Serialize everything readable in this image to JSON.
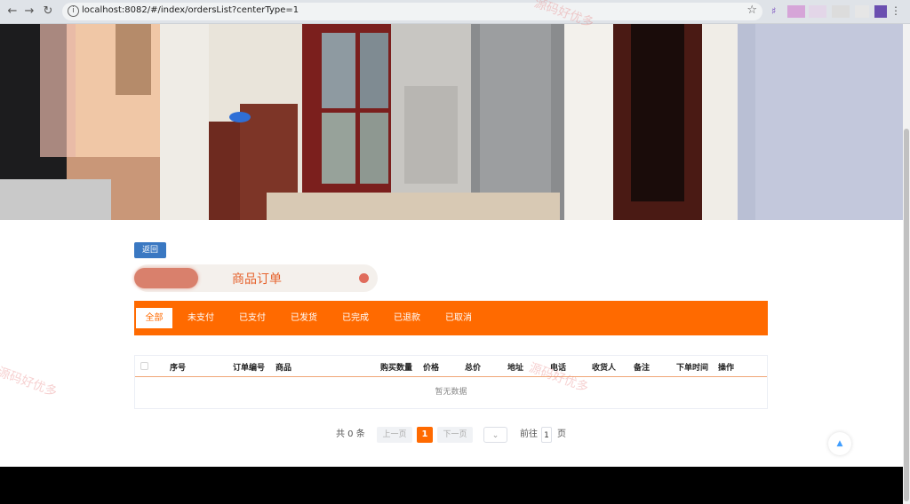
{
  "browser": {
    "url": "localhost:8082/#/index/ordersList?centerType=1"
  },
  "page": {
    "back_label": "返回",
    "title": "商品订单",
    "tabs": [
      {
        "label": "全部",
        "active": true
      },
      {
        "label": "未支付",
        "active": false
      },
      {
        "label": "已支付",
        "active": false
      },
      {
        "label": "已发货",
        "active": false
      },
      {
        "label": "已完成",
        "active": false
      },
      {
        "label": "已退款",
        "active": false
      },
      {
        "label": "已取消",
        "active": false
      }
    ],
    "table": {
      "headers": [
        "序号",
        "订单编号",
        "商品",
        "购买数量",
        "价格",
        "总价",
        "地址",
        "电话",
        "收货人",
        "备注",
        "下单时间",
        "操作"
      ],
      "empty_text": "暂无数据"
    },
    "pagination": {
      "total": "共 0 条",
      "prev": "上一页",
      "current": "1",
      "next": "下一页",
      "goto": "前往",
      "goto_value": "1",
      "page_unit": "页"
    }
  },
  "watermark": "源码好优多",
  "colors": {
    "accent": "#ff6a00",
    "back_button": "#3a78c2",
    "title_text": "#e6632e"
  }
}
